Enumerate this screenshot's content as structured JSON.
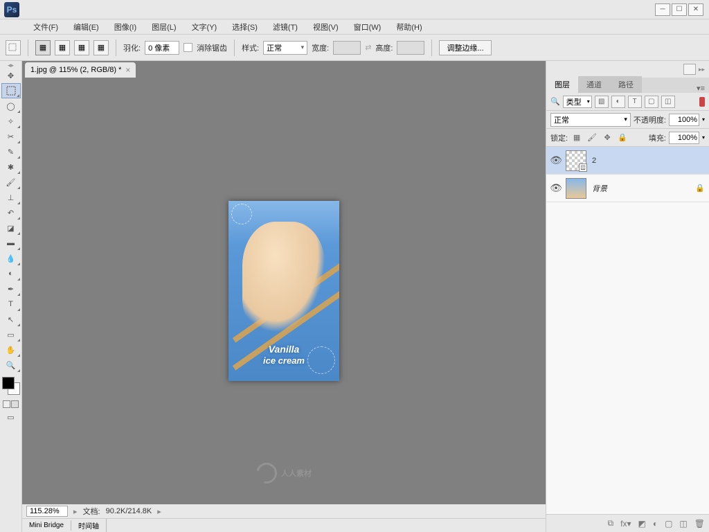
{
  "menubar": {
    "items": [
      "文件(F)",
      "编辑(E)",
      "图像(I)",
      "图层(L)",
      "文字(Y)",
      "选择(S)",
      "滤镜(T)",
      "视图(V)",
      "窗口(W)",
      "帮助(H)"
    ]
  },
  "options_bar": {
    "feather_label": "羽化:",
    "feather_value": "0 像素",
    "antialias_label": "消除锯齿",
    "style_label": "样式:",
    "style_value": "正常",
    "width_label": "宽度:",
    "height_label": "高度:",
    "refine_label": "调整边缘..."
  },
  "document": {
    "tab_title": "1.jpg @ 115% (2, RGB/8) *",
    "canvas_text1": "Vanilla",
    "canvas_text2": "ice cream",
    "watermark_text": "人人素材"
  },
  "status": {
    "zoom": "115.28%",
    "doc_label": "文档:",
    "doc_info": "90.2K/214.8K"
  },
  "bottom_tabs": [
    "Mini Bridge",
    "时间轴"
  ],
  "panels": {
    "tabs": [
      "图层",
      "通道",
      "路径"
    ],
    "filter_type": "类型",
    "blend_mode": "正常",
    "opacity_label": "不透明度:",
    "opacity_value": "100%",
    "lock_label": "锁定:",
    "fill_label": "填充:",
    "fill_value": "100%",
    "layers": [
      {
        "name": "2",
        "selected": true,
        "smart": true,
        "thumb": "checker",
        "locked": false,
        "italic": false
      },
      {
        "name": "背景",
        "selected": false,
        "smart": false,
        "thumb": "img",
        "locked": true,
        "italic": true
      }
    ],
    "search_icon": "🔍"
  }
}
